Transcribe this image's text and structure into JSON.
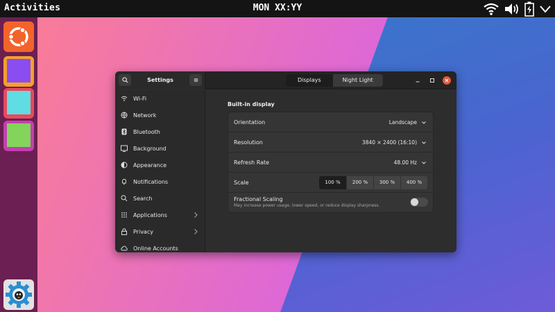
{
  "topbar": {
    "activities": "Activities",
    "clock": "MON XX:YY"
  },
  "window": {
    "title": "Settings",
    "tabs": [
      {
        "label": "Displays",
        "active": true
      },
      {
        "label": "Night Light",
        "active": false
      }
    ]
  },
  "sidebar": {
    "items": [
      {
        "label": "Wi-Fi",
        "icon": "wifi-icon"
      },
      {
        "label": "Network",
        "icon": "network-icon"
      },
      {
        "label": "Bluetooth",
        "icon": "bluetooth-icon"
      },
      {
        "label": "Background",
        "icon": "background-icon"
      },
      {
        "label": "Appearance",
        "icon": "appearance-icon"
      },
      {
        "label": "Notifications",
        "icon": "bell-icon"
      },
      {
        "label": "Search",
        "icon": "search-icon"
      },
      {
        "label": "Applications",
        "icon": "apps-grid-icon",
        "chevron": true
      },
      {
        "label": "Privacy",
        "icon": "lock-icon",
        "chevron": true
      },
      {
        "label": "Online Accounts",
        "icon": "cloud-icon"
      }
    ]
  },
  "display": {
    "section_title": "Built-in display",
    "orientation": {
      "label": "Orientation",
      "value": "Landscape"
    },
    "resolution": {
      "label": "Resolution",
      "value": "3840 × 2400 (16:10)"
    },
    "refresh": {
      "label": "Refresh Rate",
      "value": "48.00 Hz"
    },
    "scale": {
      "label": "Scale",
      "options": [
        "100 %",
        "200 %",
        "300 %",
        "400 %"
      ],
      "selected": "100 %"
    },
    "fractional": {
      "label": "Fractional Scaling",
      "description": "May increase power usage, lower speed, or reduce display sharpness.",
      "enabled": false
    }
  },
  "colors": {
    "accent_close": "#e65a3b",
    "dock": "#6b1f52",
    "ubuntu": "#f2642b"
  }
}
